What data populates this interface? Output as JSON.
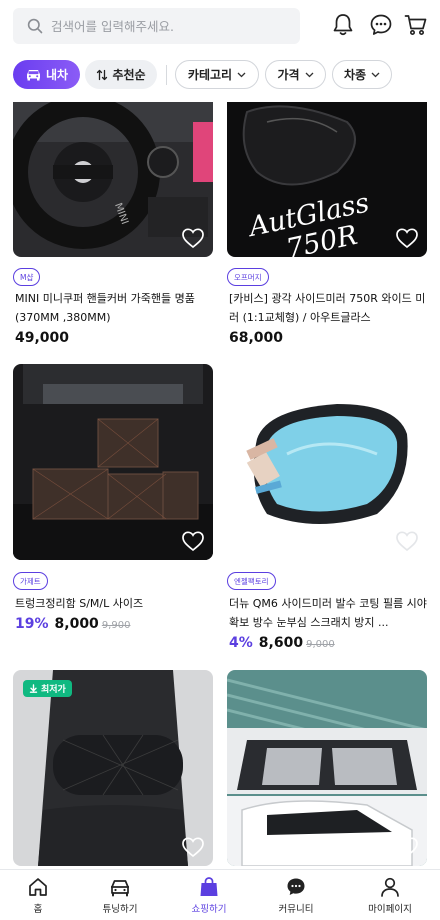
{
  "search": {
    "placeholder": "검색어를 입력해주세요."
  },
  "filters": {
    "vehicle": "내차",
    "sort": "추천순",
    "category": "카테고리",
    "price": "가격",
    "car_type": "차종"
  },
  "products": [
    {
      "tag": "M샵",
      "title": "MINI 미니쿠퍼 핸들커버 가죽핸들 명품 (370MM ,380MM)",
      "discount": "",
      "price": "49,000",
      "original": ""
    },
    {
      "tag": "오프머지",
      "title": "[카비스] 광각 사이드미러 750R 와이드 미러 (1:1교체형) / 아우트글라스",
      "discount": "",
      "price": "68,000",
      "original": "",
      "image_text_1": "AutGlass",
      "image_text_2": "750R"
    },
    {
      "tag": "가제트",
      "title": "트렁크정리함 S/M/L 사이즈",
      "discount": "19%",
      "price": "8,000",
      "original": "9,900"
    },
    {
      "tag": "엔젤팩토리",
      "title": "더뉴 QM6 사이드미러 발수 코팅 필름 시야확보 방수 눈부심 스크래치 방지 ...",
      "discount": "4%",
      "price": "8,600",
      "original": "9,000"
    },
    {
      "badge": "최저가"
    }
  ],
  "nav": [
    {
      "label": "홈",
      "icon": "home-icon"
    },
    {
      "label": "튜닝하기",
      "icon": "car-icon"
    },
    {
      "label": "쇼핑하기",
      "icon": "shopping-bag-icon",
      "active": true
    },
    {
      "label": "커뮤니티",
      "icon": "chat-icon"
    },
    {
      "label": "마이페이지",
      "icon": "profile-icon"
    }
  ],
  "colors": {
    "accent": "#5b3fe0",
    "lowest_badge": "#10b981"
  }
}
